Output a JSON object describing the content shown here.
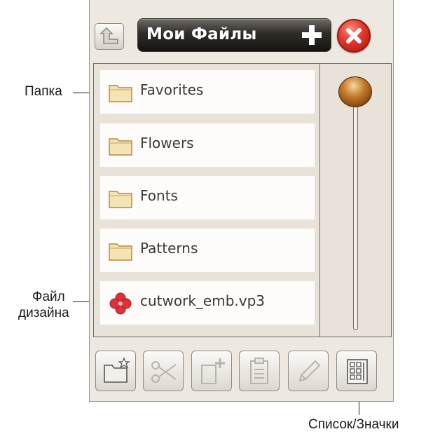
{
  "title": "Мои Файлы",
  "files": [
    {
      "label": "Favorites",
      "icon": "folder-icon"
    },
    {
      "label": "Flowers",
      "icon": "folder-icon"
    },
    {
      "label": "Fonts",
      "icon": "folder-icon"
    },
    {
      "label": "Patterns",
      "icon": "folder-icon"
    },
    {
      "label": "cutwork_emb.vp3",
      "icon": "embroidery-design-icon"
    }
  ],
  "toolbar": [
    "new-folder-icon",
    "cut-icon",
    "copy-icon",
    "paste-icon",
    "rename-icon",
    "list-icons-view-icon"
  ],
  "callouts": {
    "folder": "Папка",
    "design_file_line1": "Файл",
    "design_file_line2": "дизайна",
    "list_icons": "Список/Значки"
  },
  "colors": {
    "panel_bg": "#ede8e0",
    "title_bar": "#2f2c28",
    "close_button": "#e2372a",
    "folder": "#f3d9a0",
    "design_flower": "#e0303a",
    "scroll_knob": "#c47a28"
  }
}
